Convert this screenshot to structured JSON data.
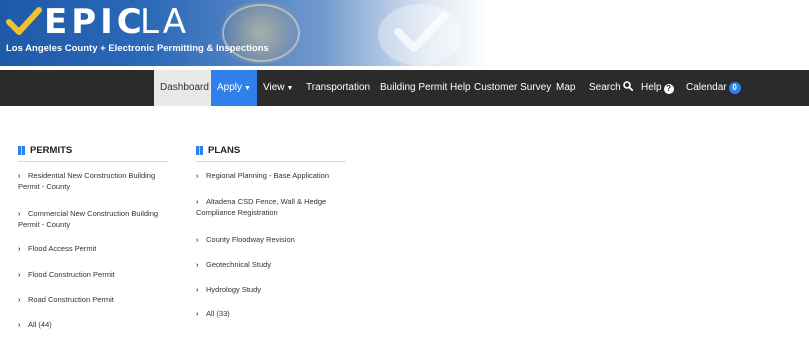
{
  "header": {
    "logo_epic": "EPIC",
    "logo_la": "LA",
    "subtitle": "Los Angeles County + Electronic Permitting & Inspections"
  },
  "nav": {
    "dashboard": "Dashboard",
    "apply": "Apply",
    "view": "View",
    "transportation": "Transportation",
    "building_permit_help": "Building Permit Help",
    "customer_survey": "Customer Survey",
    "map": "Map",
    "search": "Search",
    "help": "Help",
    "calendar": "Calendar",
    "calendar_count": "0"
  },
  "permits": {
    "title": "PERMITS",
    "items": [
      {
        "line1": "Residential New Construction Building",
        "line2": "Permit - County"
      },
      {
        "line1": "Commercial New Construction Building",
        "line2": "Permit - County"
      },
      {
        "line1": "Flood Access Permit",
        "line2": ""
      },
      {
        "line1": "Flood Construction Permit",
        "line2": ""
      },
      {
        "line1": "Road Construction Permit",
        "line2": ""
      },
      {
        "line1": "All (44)",
        "line2": ""
      }
    ]
  },
  "plans": {
    "title": "PLANS",
    "items": [
      {
        "line1": "Regional Planning - Base Application",
        "line2": ""
      },
      {
        "line1": "Altadena CSD Fence, Wall & Hedge",
        "line2": "Compliance Registration"
      },
      {
        "line1": "County Floodway Revision",
        "line2": ""
      },
      {
        "line1": "Geotechnical Study",
        "line2": ""
      },
      {
        "line1": "Hydrology Study",
        "line2": ""
      },
      {
        "line1": "All (33)",
        "line2": ""
      }
    ]
  },
  "icons": {
    "logo": "check-mark-icon",
    "section": "book-icon",
    "item": "chevron-right-icon",
    "search": "search-icon",
    "help": "question-circle-icon",
    "dropdown": "caret-down-icon"
  },
  "colors": {
    "navbar": "#2b2b2b",
    "accent": "#2f80ed",
    "banner": "#1f5aa8"
  }
}
